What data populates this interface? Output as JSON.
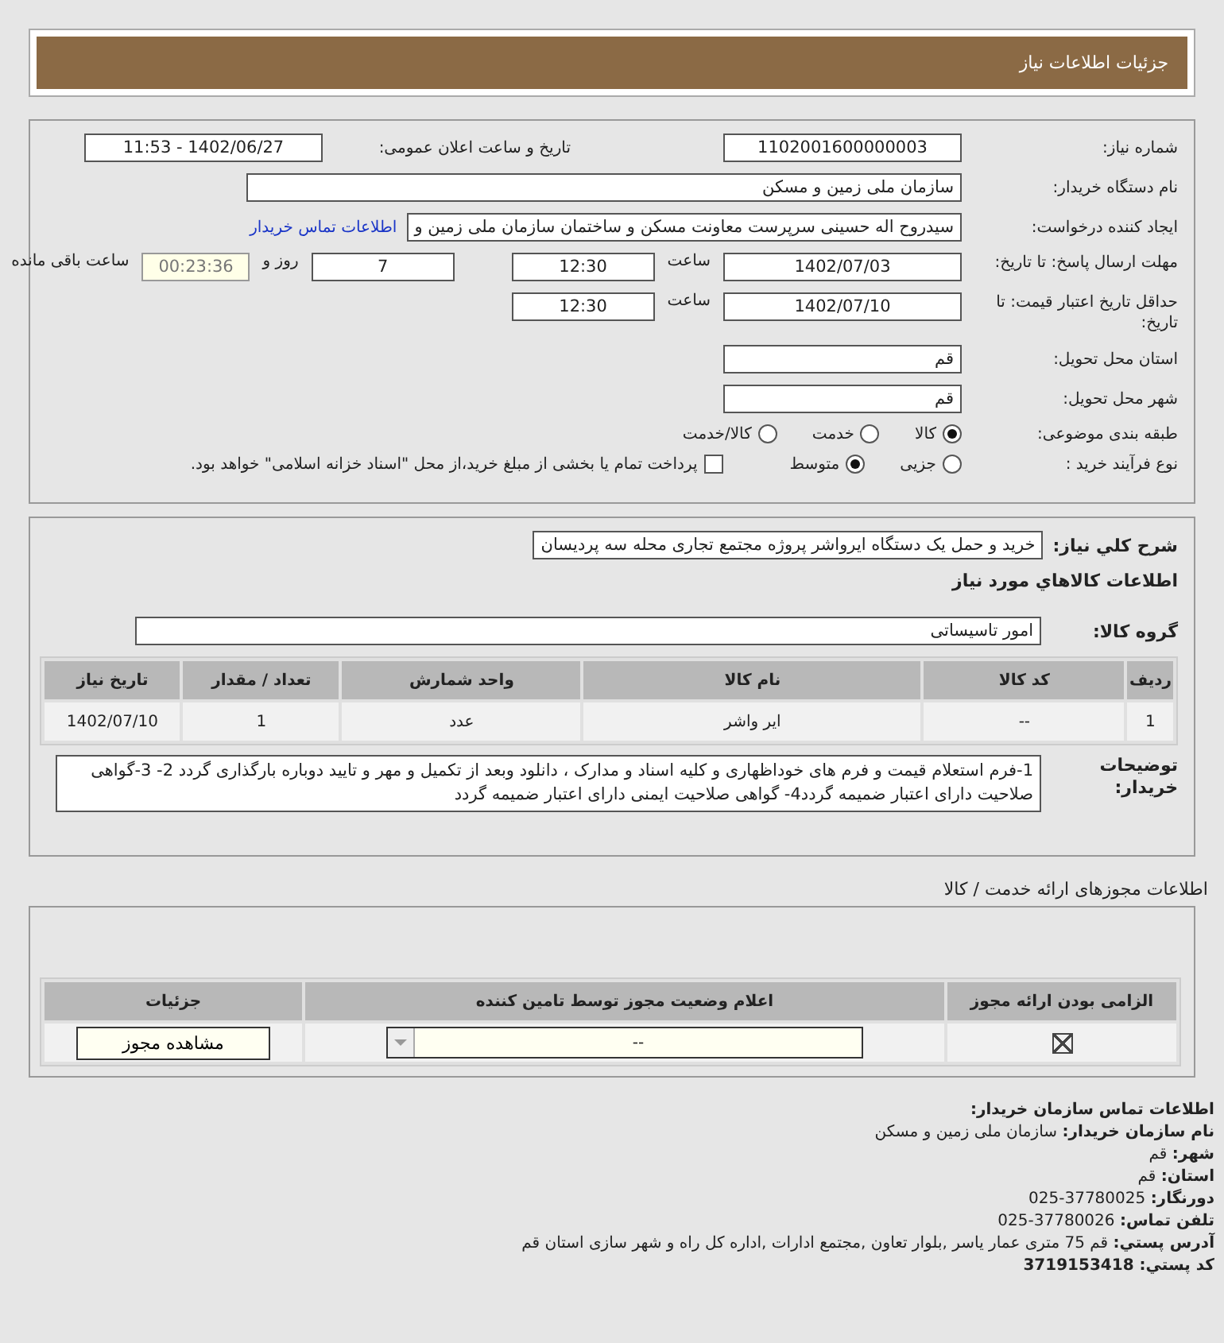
{
  "header": {
    "title": "جزئیات اطلاعات نیاز"
  },
  "need": {
    "number_label": "شماره نیاز:",
    "number": "1102001600000003",
    "announce_label": "تاریخ و ساعت اعلان عمومی:",
    "announce": "1402/06/27 - 11:53",
    "buyer_label": "نام دستگاه خریدار:",
    "buyer": "سازمان ملی زمین و مسکن",
    "creator_label": "ایجاد کننده درخواست:",
    "creator": "سیدروح اله حسینی سرپرست معاونت مسکن و ساختمان سازمان ملی زمین و",
    "contact_link": "اطلاعات تماس خریدار",
    "deadline_label": "مهلت ارسال پاسخ: تا تاریخ:",
    "deadline_date": "1402/07/03",
    "time_label": "ساعت",
    "deadline_time": "12:30",
    "days": "7",
    "days_label": "روز و",
    "remaining": "00:23:36",
    "remaining_label": "ساعت باقی مانده",
    "validity_label": "حداقل تاریخ اعتبار قیمت: تا تاریخ:",
    "validity_date": "1402/07/10",
    "validity_time_label": "ساعت",
    "validity_time": "12:30",
    "province_label": "استان محل تحویل:",
    "province": "قم",
    "city_label": "شهر محل تحویل:",
    "city": "قم",
    "category_label": "طبقه بندی موضوعی:",
    "categories": [
      {
        "label": "کالا",
        "selected": true
      },
      {
        "label": "خدمت",
        "selected": false
      },
      {
        "label": "کالا/خدمت",
        "selected": false
      }
    ],
    "process_label": "نوع فرآیند خرید :",
    "processes": [
      {
        "label": "جزیی",
        "selected": false
      },
      {
        "label": "متوسط",
        "selected": true
      }
    ],
    "payment": {
      "label": "پرداخت تمام یا بخشی از مبلغ خرید،از محل \"اسناد خزانه اسلامی\" خواهد بود.",
      "checked": false
    }
  },
  "goods": {
    "summary_label": "شرح کلي نياز:",
    "summary": "خرید و حمل یک دستگاه ایرواشر پروژه مجتمع تجاری محله سه پردیسان",
    "title": "اطلاعات کالاهاي مورد نياز",
    "group_label": "گروه کالا:",
    "group": "امور تاسیساتی",
    "columns": [
      "ردیف",
      "کد کالا",
      "نام کالا",
      "واحد شمارش",
      "تعداد / مقدار",
      "تاریخ نیاز"
    ],
    "rows": [
      [
        "1",
        "--",
        "ایر واشر",
        "عدد",
        "1",
        "1402/07/10"
      ]
    ],
    "notes_label": "توضیحات خریدار:",
    "notes": "1-فرم استعلام قیمت و فرم های خوداظهاری و کلیه اسناد و مدارک ، دانلود وبعد از تکمیل و مهر و تایید دوباره بارگذاری گردد 2- 3-گواهی صلاحیت دارای اعتبار ضمیمه گردد4- گواهی صلاحیت ایمنی دارای اعتبار ضمیمه گردد"
  },
  "permits": {
    "title": "اطلاعات مجوزهای ارائه خدمت / کالا",
    "columns": [
      "الزامی بودن ارائه مجوز",
      "اعلام وضعیت مجوز توسط تامین کننده",
      "جزئیات"
    ],
    "rows": [
      {
        "required": true,
        "status": "--",
        "button": "مشاهده مجوز"
      }
    ]
  },
  "contact": {
    "title": "اطلاعات تماس سازمان خریدار:",
    "lines": [
      {
        "label": "نام سازمان خریدار:",
        "value": "سازمان ملی زمین و مسکن"
      },
      {
        "label": "شهر:",
        "value": "قم"
      },
      {
        "label": "استان:",
        "value": "قم"
      },
      {
        "label": "دورنگار:",
        "value": "37780025-025"
      },
      {
        "label": "تلفن تماس:",
        "value": "37780026-025"
      },
      {
        "label": "آدرس پستي:",
        "value": "قم 75 متری عمار یاسر ,بلوار تعاون ,مجتمع ادارات ,اداره کل راه و شهر سازی استان قم"
      },
      {
        "label": "کد پستي:",
        "value": "3719153418"
      }
    ]
  }
}
